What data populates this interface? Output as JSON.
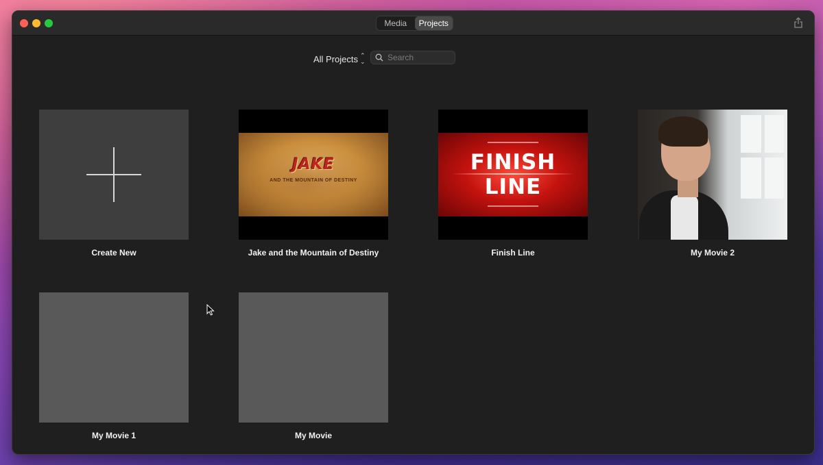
{
  "titlebar": {
    "tabs": [
      {
        "label": "Media",
        "active": false
      },
      {
        "label": "Projects",
        "active": true
      }
    ]
  },
  "toolbar": {
    "filter_label": "All Projects",
    "search_placeholder": "Search"
  },
  "projects": [
    {
      "label": "Create New",
      "kind": "create"
    },
    {
      "label": "Jake and the Mountain of Destiny",
      "kind": "trailer"
    },
    {
      "label": "Finish Line",
      "kind": "trailer"
    },
    {
      "label": "My Movie 2",
      "kind": "movie"
    },
    {
      "label": "My Movie 1",
      "kind": "movie"
    },
    {
      "label": "My Movie",
      "kind": "movie"
    }
  ],
  "thumb_text": {
    "jake_title": "JAKE",
    "jake_subtitle": "AND THE MOUNTAIN OF DESTINY",
    "finish_line_1": "FINISH",
    "finish_line_2": "LINE"
  },
  "colors": {
    "window_bg": "#1f1f1f",
    "titlebar_bg": "#2a2a2a",
    "create_tile": "#3e3e3e",
    "blank_tile": "#595959"
  }
}
